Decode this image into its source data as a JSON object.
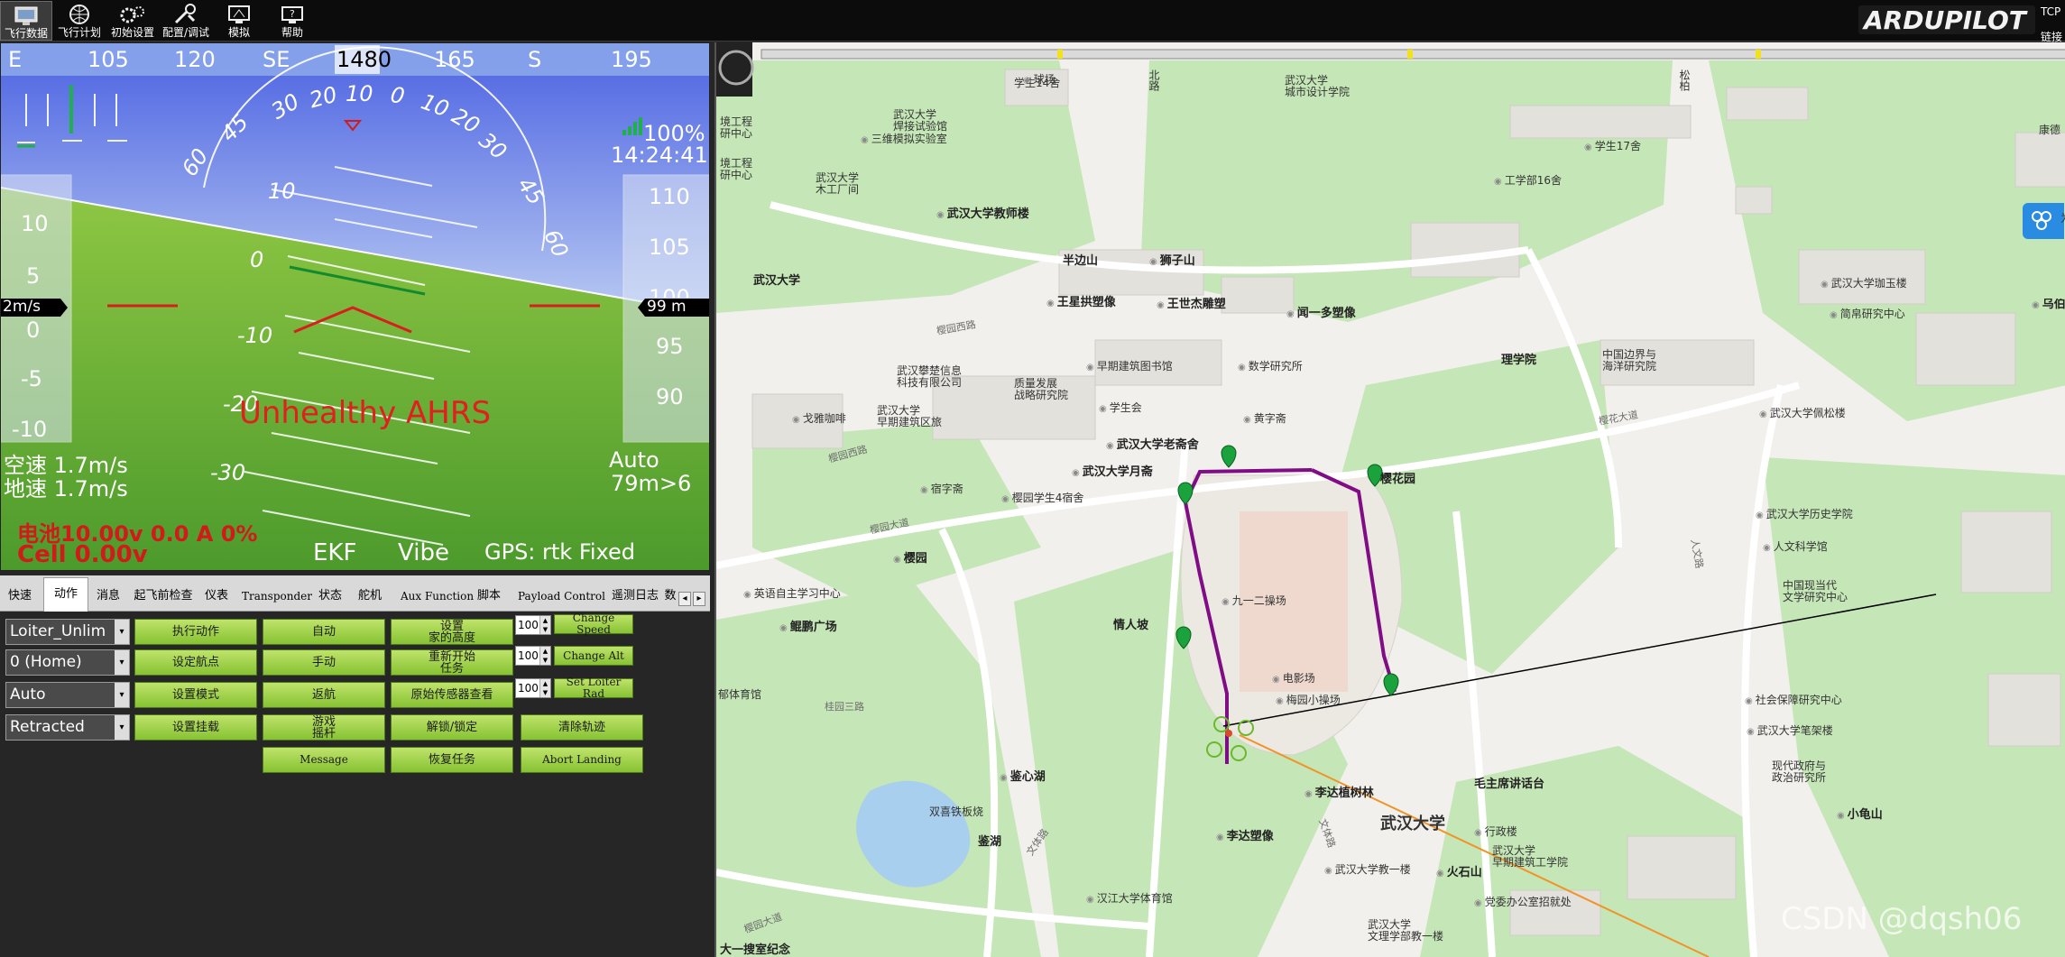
{
  "toolbar": {
    "buttons": [
      {
        "label": "飞行数据",
        "icon": "flight-data-icon"
      },
      {
        "label": "飞行计划",
        "icon": "flight-plan-icon"
      },
      {
        "label": "初始设置",
        "icon": "initial-setup-icon"
      },
      {
        "label": "配置/调试",
        "icon": "config-tuning-icon"
      },
      {
        "label": "模拟",
        "icon": "simulation-icon"
      },
      {
        "label": "帮助",
        "icon": "help-icon"
      }
    ],
    "logo_text": "ARDUPILOT",
    "connection": "TCP",
    "connection_sub": "链接"
  },
  "hud": {
    "compass": [
      "E",
      "105",
      "120",
      "SE",
      "1480",
      "165",
      "S",
      "195"
    ],
    "pitch_labels": [
      "10",
      "0",
      "-10",
      "-20",
      "-30"
    ],
    "roll_labels": [
      "60",
      "45",
      "30",
      "20",
      "10",
      "0",
      "10",
      "20",
      "30",
      "45",
      "60"
    ],
    "speed_ticks": [
      "10",
      "5",
      "0",
      "-5",
      "-10"
    ],
    "speed_box": "2m/s",
    "alt_ticks": [
      "110",
      "105",
      "100",
      "95",
      "90"
    ],
    "alt_box": "99 m",
    "battery_signal": "100%",
    "time": "14:24:41",
    "warning": "Unhealthy AHRS",
    "airspeed": "空速 1.7m/s",
    "groundspeed": "地速 1.7m/s",
    "mode": "Auto",
    "wp": "79m>6",
    "battery": "电池10.00v 0.0 A 0%",
    "cell": "Cell 0.00v",
    "ekf": "EKF",
    "vibe": "Vibe",
    "gps": "GPS: rtk Fixed",
    "colors": {
      "sky": "#6e86e6",
      "ground": "#7fc63e",
      "warning": "#d11a1a"
    }
  },
  "tabs": [
    "快速",
    "动作",
    "消息",
    "起飞前检查",
    "仪表",
    "Transponder",
    "状态",
    "舵机",
    "Aux Function",
    "脚本",
    "Payload Control",
    "遥测日志",
    "数"
  ],
  "tab_active": "动作",
  "actions": {
    "combos": [
      "Loiter_Unlim",
      "0 (Home)",
      "Auto",
      "Retracted"
    ],
    "col1": [
      "执行动作",
      "设定航点",
      "设置模式",
      "设置挂载"
    ],
    "col2": [
      "自动",
      "手动",
      "返航",
      "游戏\n摇杆",
      "Message"
    ],
    "col3": [
      "设置\n家的高度",
      "重新开始\n任务",
      "原始传感器查看",
      "解锁/锁定",
      "恢复任务"
    ],
    "spin_values": [
      "100",
      "100",
      "100"
    ],
    "col4": [
      "Change Speed",
      "Change Alt",
      "Set Loiter Rad"
    ],
    "col4b": [
      "清除轨迹",
      "Abort Landing"
    ]
  },
  "map": {
    "labels": {
      "campus": "武汉大学",
      "campus_w": "武汉大学",
      "science_school": "理学院",
      "old_dorm": "武汉大学老斋舍",
      "lecture_hall": "毛主席讲话台",
      "stadium": "九一二操场",
      "sakura_garden": "樱花园",
      "sakura_road": "樱花大道",
      "sakura_west": "樱园西路",
      "lake": "鉴湖",
      "lake_heart": "鉴心湖",
      "lover_slope": "情人坡",
      "luojia_square": "鲲鹏广场",
      "sakura_yard": "樱园",
      "banbianshan": "半边山",
      "shizishan": "狮子山",
      "wang_xingbao": "王星拱塑像",
      "wang_shijie": "王世杰雕塑",
      "wen_yiduo": "闻一多塑像",
      "li_da_tree": "李达植树林",
      "li_da_statue": "李达塑像",
      "huoshishan": "火石山",
      "admin": "行政楼",
      "math": "数学研究所",
      "huang_zhai": "黄字斋",
      "student_hall": "学生会",
      "yuezhai": "武汉大学月斋",
      "cinema": "电影场",
      "meiyuan": "梅园小操场",
      "dorm_14": "学生14舍",
      "dorm_17": "学生17舍",
      "eng_16": "工学部16舍",
      "city_design": "武汉大学\n城市设计学院",
      "welding": "武汉大学\n焊接试验馆",
      "lab3": "三维模拟实验室",
      "teacher_house": "武汉大学教师楼",
      "eng_center": "境工程\n研中心",
      "eng_center2": "境工程\n研中心",
      "wood": "武汉大学\n木工厂间",
      "qingyuan": "球场",
      "panhan": "武汉攀楚信息\n科技有限公司",
      "quality": "质量发展\n战略研究院",
      "early_arch": "早期建筑图书馆",
      "early_arch2": "武汉大学\n早期建筑区旅",
      "gege": "戈雅咖啡",
      "suse": "宿字斋",
      "sakura_dorm": "樱园学生4宿舍",
      "border": "中国边界与\n海洋研究院",
      "jiamu": "武汉大学珈玉楼",
      "jianmo": "简帛研究中心",
      "peisong": "武汉大学佩松楼",
      "history": "武汉大学历史学院",
      "humanities": "人文科学馆",
      "modern_culture": "中国现当代\n文学研究中心",
      "social": "社会保障研究中心",
      "bizhen": "武汉大学笔架楼",
      "modern_gov": "现代政府与\n政治研究所",
      "xiaoguishan": "小龟山",
      "study": "英语自主学习中心",
      "yulin": "郁体育馆",
      "jianhu_island": "双喜铁板烧",
      "gym": "汉江大学体育馆",
      "teacher_1": "武汉大学教一楼",
      "party": "党委办公室招就处",
      "early_eng": "武汉大学\n早期建筑工学院",
      "lit": "武汉大学\n文理学部教一楼",
      "sakura_north": "樱园大道",
      "wenhua": "文体路",
      "guiyuan": "桂园三路",
      "renwen_road": "人文路",
      "bottom_1": "大一搜室纪念",
      "bottom_road": "樱园大道",
      "wuyi": "乌伯",
      "kangdai": "康德",
      "toolbox_txt": "为",
      "north": "北路",
      "songmu": "松柏"
    }
  },
  "watermark": "CSDN @dqsh06"
}
